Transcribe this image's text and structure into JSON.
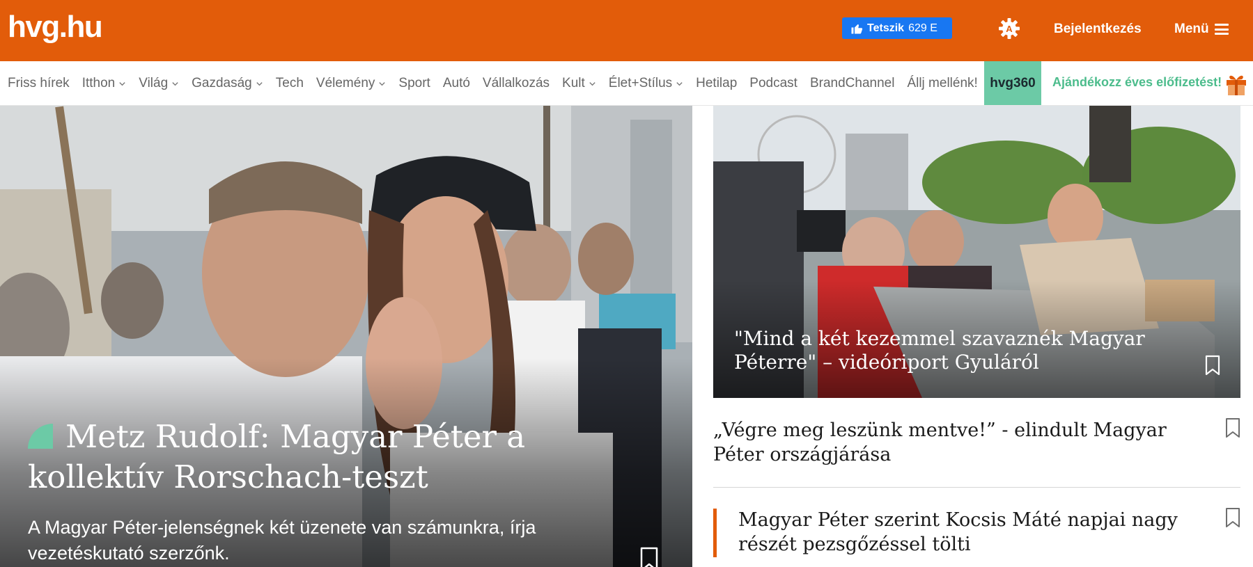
{
  "header": {
    "logo": "hvg.hu",
    "like_label": "Tetszik",
    "like_count": "629 E",
    "login_label": "Bejelentkezés",
    "menu_label": "Menü",
    "brand_color": "#e25c0a"
  },
  "nav": {
    "items": [
      {
        "label": "Friss hírek",
        "dropdown": false
      },
      {
        "label": "Itthon",
        "dropdown": true
      },
      {
        "label": "Világ",
        "dropdown": true
      },
      {
        "label": "Gazdaság",
        "dropdown": true
      },
      {
        "label": "Tech",
        "dropdown": false
      },
      {
        "label": "Vélemény",
        "dropdown": true
      },
      {
        "label": "Sport",
        "dropdown": false
      },
      {
        "label": "Autó",
        "dropdown": false
      },
      {
        "label": "Vállalkozás",
        "dropdown": false
      },
      {
        "label": "Kult",
        "dropdown": true
      },
      {
        "label": "Élet+Stílus",
        "dropdown": true
      },
      {
        "label": "Hetilap",
        "dropdown": false
      },
      {
        "label": "Podcast",
        "dropdown": false
      },
      {
        "label": "BrandChannel",
        "dropdown": false
      },
      {
        "label": "Állj mellénk!",
        "dropdown": false
      }
    ],
    "hvg360_label": "hvg360",
    "gift_label": "Ajándékozz éves előfizetést!",
    "accent_color": "#6ccaa6"
  },
  "hero": {
    "title": "Metz Rudolf: Magyar Péter a kollektív Rorschach-teszt",
    "lead": "A Magyar Péter-jelenségnek két üzenete van számunkra, írja vezetéskutató szerzőnk."
  },
  "feature": {
    "title": "\"Mind a két kezemmel szavaznék Magyar Péterre\" – videóriport Gyuláról"
  },
  "articles": [
    {
      "title": "„Végre meg leszünk mentve!” - elindult Magyar Péter országjárása"
    },
    {
      "title": "Magyar Péter szerint Kocsis Máté napjai nagy részét pezsgőzéssel tölti"
    }
  ]
}
